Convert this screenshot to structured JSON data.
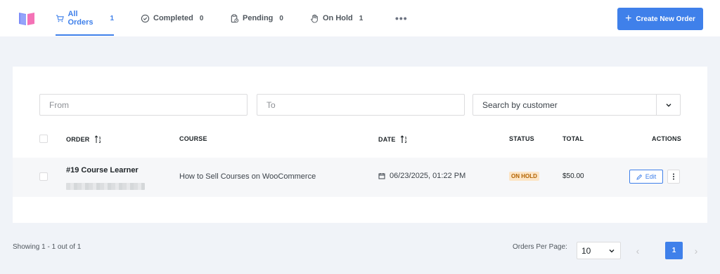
{
  "nav": {
    "tabs": [
      {
        "label": "All Orders",
        "count": "1",
        "icon": "cart-icon",
        "active": true
      },
      {
        "label": "Completed",
        "count": "0",
        "icon": "check-circle-icon",
        "active": false
      },
      {
        "label": "Pending",
        "count": "0",
        "icon": "clipboard-clock-icon",
        "active": false
      },
      {
        "label": "On Hold",
        "count": "1",
        "icon": "hand-icon",
        "active": false
      }
    ],
    "more_label": "•••",
    "create_label": "Create New Order"
  },
  "filters": {
    "from_placeholder": "From",
    "to_placeholder": "To",
    "customer_label": "Search by customer"
  },
  "table": {
    "headers": {
      "order": "ORDER",
      "course": "COURSE",
      "date": "DATE",
      "status": "STATUS",
      "total": "TOTAL",
      "actions": "ACTIONS"
    },
    "rows": [
      {
        "order": "#19 Course Learner",
        "course": "How to Sell Courses on WooCommerce",
        "date": "06/23/2025, 01:22 PM",
        "status": "ON HOLD",
        "total": "$50.00",
        "edit_label": "Edit"
      }
    ]
  },
  "footer": {
    "showing": "Showing 1 - 1 out of 1",
    "per_page_label": "Orders Per Page:",
    "per_page_value": "10",
    "current_page": "1",
    "prev_label": "‹",
    "next_label": "›"
  },
  "colors": {
    "accent": "#3f80ea",
    "status_on_hold_bg": "#fce5c6",
    "status_on_hold_text": "#b26200"
  }
}
